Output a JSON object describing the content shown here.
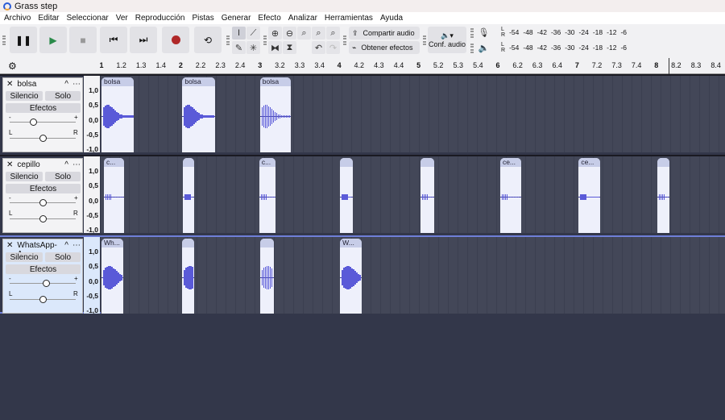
{
  "app": {
    "title": "Grass step"
  },
  "menu": [
    "Archivo",
    "Editar",
    "Seleccionar",
    "Ver",
    "Reproducción",
    "Pistas",
    "Generar",
    "Efecto",
    "Analizar",
    "Herramientas",
    "Ayuda"
  ],
  "toolbar": {
    "share_audio": "Compartir audio",
    "get_effects": "Obtener efectos",
    "audio_setup": "Conf. audio",
    "meter_ticks": [
      "-54",
      "-48",
      "-42",
      "-36",
      "-30",
      "-24",
      "-18",
      "-12",
      "-6"
    ],
    "record_color": "#b02828",
    "play_color": "#2a8a4a"
  },
  "ruler": {
    "labels": [
      [
        "1",
        1,
        true
      ],
      [
        "1.2",
        1.25
      ],
      [
        "1.3",
        1.5
      ],
      [
        "1.4",
        1.75
      ],
      [
        "2",
        2,
        true
      ],
      [
        "2.2",
        2.25
      ],
      [
        "2.3",
        2.5
      ],
      [
        "2.4",
        2.75
      ],
      [
        "3",
        3,
        true
      ],
      [
        "3.2",
        3.25
      ],
      [
        "3.3",
        3.5
      ],
      [
        "3.4",
        3.75
      ],
      [
        "4",
        4,
        true
      ],
      [
        "4.2",
        4.25
      ],
      [
        "4.3",
        4.5
      ],
      [
        "4.4",
        4.75
      ],
      [
        "5",
        5,
        true
      ],
      [
        "5.2",
        5.25
      ],
      [
        "5.3",
        5.5
      ],
      [
        "5.4",
        5.75
      ],
      [
        "6",
        6,
        true
      ],
      [
        "6.2",
        6.25
      ],
      [
        "6.3",
        6.5
      ],
      [
        "6.4",
        6.75
      ],
      [
        "7",
        7,
        true
      ],
      [
        "7.2",
        7.25
      ],
      [
        "7.3",
        7.5
      ],
      [
        "7.4",
        7.75
      ],
      [
        "8",
        8,
        true
      ],
      [
        "8.2",
        8.25
      ],
      [
        "8.3",
        8.5
      ],
      [
        "8.4",
        8.75
      ]
    ],
    "playhead": 8.15
  },
  "track_labels": {
    "mute": "Silencio",
    "solo": "Solo",
    "effects": "Efectos",
    "left": "L",
    "right": "R",
    "minus": "-",
    "plus": "+",
    "scale": [
      "1,0",
      "0,5",
      "0,0",
      "-0,5",
      "-1,0"
    ]
  },
  "tracks": [
    {
      "name": "bolsa",
      "selected": false,
      "gain": 0.35,
      "pan": 0.5,
      "clips": [
        {
          "label": "bolsa",
          "start": 1.0,
          "end": 1.41
        },
        {
          "label": "bolsa",
          "start": 2.02,
          "end": 2.43
        },
        {
          "label": "bolsa",
          "start": 3.0,
          "end": 3.39
        }
      ]
    },
    {
      "name": "cepillo",
      "selected": false,
      "gain": 0.5,
      "pan": 0.5,
      "clips": [
        {
          "label": "c...",
          "start": 1.03,
          "end": 1.28
        },
        {
          "label": "",
          "start": 2.03,
          "end": 2.17
        },
        {
          "label": "c...",
          "start": 2.99,
          "end": 3.2
        },
        {
          "label": "",
          "start": 4.01,
          "end": 4.17
        },
        {
          "label": "",
          "start": 5.02,
          "end": 5.2
        },
        {
          "label": "ce...",
          "start": 6.03,
          "end": 6.29
        },
        {
          "label": "ce...",
          "start": 7.02,
          "end": 7.29
        },
        {
          "label": "",
          "start": 8.01,
          "end": 8.16
        }
      ]
    },
    {
      "name": "WhatsApp-A...",
      "selected": true,
      "gain": 0.55,
      "pan": 0.5,
      "clips": [
        {
          "label": "Wh...",
          "start": 1.0,
          "end": 1.27
        },
        {
          "label": "",
          "start": 2.02,
          "end": 2.17
        },
        {
          "label": "",
          "start": 3.0,
          "end": 3.17
        },
        {
          "label": "W...",
          "start": 4.01,
          "end": 4.28
        }
      ]
    }
  ]
}
